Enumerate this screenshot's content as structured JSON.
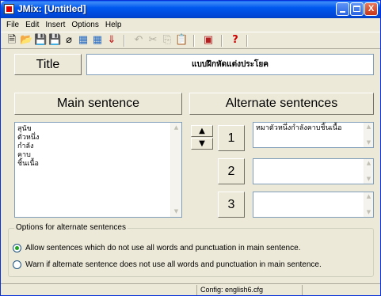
{
  "window": {
    "title": "JMix: [Untitled]",
    "buttons": {
      "minimize": "",
      "maximize": "",
      "close": "X"
    }
  },
  "menu": [
    "File",
    "Edit",
    "Insert",
    "Options",
    "Help"
  ],
  "toolbar": {
    "icons": [
      "new-icon",
      "open-icon",
      "save-icon",
      "save-as-icon",
      "clear-icon",
      "export-icon",
      "export-all-icon",
      "upload-icon",
      "undo-icon",
      "cut-icon",
      "copy-icon",
      "paste-icon",
      "configure-icon",
      "help-icon"
    ],
    "glyphs": {
      "new": "🗎",
      "open": "📂",
      "save": "💾",
      "save_as": "💾",
      "clear": "⌀",
      "export": "▦",
      "export_all": "▦",
      "upload": "⇓",
      "undo": "↶",
      "cut": "✂",
      "copy": "⎘",
      "paste": "📋",
      "configure": "▣",
      "help": "?"
    }
  },
  "title_field": {
    "label": "Title",
    "value": "แบบฝึกหัดแต่งประโยค"
  },
  "main_sentence": {
    "header": "Main sentence",
    "lines": [
      "สุนัข",
      "ตัวหนึ่ง",
      "กำลัง",
      "คาบ",
      "ชิ้นเนื้อ"
    ]
  },
  "move_buttons": {
    "up": "▲",
    "down": "▼"
  },
  "alternate_sentences": {
    "header": "Alternate sentences",
    "items": [
      {
        "number": "1",
        "value": "หมาตัวหนึ่งกำลังคาบชิ้นเนื้อ"
      },
      {
        "number": "2",
        "value": ""
      },
      {
        "number": "3",
        "value": ""
      }
    ]
  },
  "options": {
    "legend": "Options for alternate sentences",
    "allow_label": "Allow sentences which do not use all words and punctuation in main sentence.",
    "warn_label": "Warn if alternate sentence does not use all words and punctuation in main sentence.",
    "selected": "allow"
  },
  "status": {
    "config": "Config: english6.cfg"
  },
  "scroll_glyphs": {
    "up": "▲",
    "down": "▼"
  }
}
